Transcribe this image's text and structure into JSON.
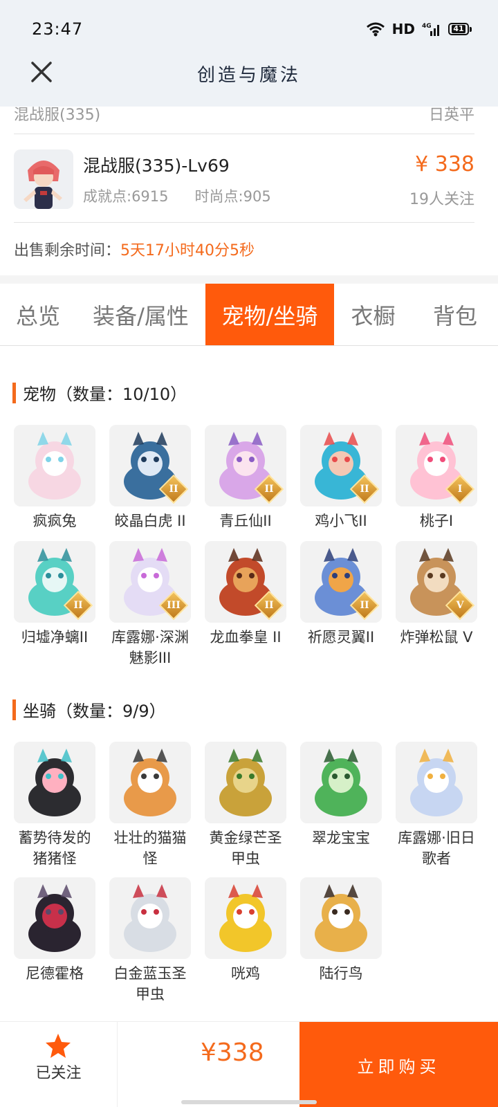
{
  "status_bar": {
    "time": "23:47",
    "network": "HD",
    "signal": "4G",
    "battery": "41"
  },
  "header": {
    "title": "创造与魔法"
  },
  "prev_row": {
    "left": "混战服(335)",
    "right": "日英平"
  },
  "character": {
    "name": "混战服(335)-Lv69",
    "achievement": "成就点:6915",
    "fashion": "时尚点:905",
    "price": "¥ 338",
    "followers": "19人关注"
  },
  "sale_time": {
    "label": "出售剩余时间：",
    "value": "5天17小时40分5秒"
  },
  "tabs": [
    {
      "label": "总览",
      "active": false
    },
    {
      "label": "装备/属性",
      "active": false
    },
    {
      "label": "宠物/坐骑",
      "active": true
    },
    {
      "label": "衣橱",
      "active": false
    },
    {
      "label": "背包",
      "active": false
    }
  ],
  "pets": {
    "title": "宠物",
    "count": "（数量：10/10）",
    "items": [
      {
        "label": "疯疯兔",
        "badge": "",
        "icon": "rabbit-icon"
      },
      {
        "label": "皎晶白虎 II",
        "badge": "II",
        "icon": "tiger-icon"
      },
      {
        "label": "青丘仙II",
        "badge": "II",
        "icon": "fox-fairy-icon"
      },
      {
        "label": "鸡小飞II",
        "badge": "II",
        "icon": "chick-icon"
      },
      {
        "label": "桃子I",
        "badge": "I",
        "icon": "pink-cat-icon"
      },
      {
        "label": "归墟净螭II",
        "badge": "II",
        "icon": "water-dragon-icon"
      },
      {
        "label": "库露娜·深渊魅影III",
        "badge": "III",
        "icon": "kuluna-icon"
      },
      {
        "label": "龙血拳皇 II",
        "badge": "II",
        "icon": "red-dragon-icon"
      },
      {
        "label": "祈愿灵翼II",
        "badge": "II",
        "icon": "griffin-icon"
      },
      {
        "label": "炸弹松鼠 V",
        "badge": "V",
        "icon": "squirrel-icon"
      }
    ]
  },
  "mounts": {
    "title": "坐骑",
    "count": "（数量：9/9）",
    "items": [
      {
        "label": "蓄势待发的猪猪怪",
        "icon": "pig-icon"
      },
      {
        "label": "壮壮的猫猫怪",
        "icon": "cat-icon"
      },
      {
        "label": "黄金绿芒圣甲虫",
        "icon": "gold-beetle-icon"
      },
      {
        "label": "翠龙宝宝",
        "icon": "green-dragon-icon"
      },
      {
        "label": "库露娜·旧日歌者",
        "icon": "kuluna-singer-icon"
      },
      {
        "label": "尼德霍格",
        "icon": "black-dragon-icon"
      },
      {
        "label": "白金蓝玉圣甲虫",
        "icon": "white-beetle-icon"
      },
      {
        "label": "咣鸡",
        "icon": "yellow-bird-icon"
      },
      {
        "label": "陆行鸟",
        "icon": "ostrich-icon"
      }
    ]
  },
  "bottom_bar": {
    "follow_label": "已关注",
    "price": "¥338",
    "buy_label": "立即购买"
  },
  "colors": {
    "accent": "#ff5a0c",
    "price": "#f46a1c",
    "header_bg": "#eef2f6"
  }
}
